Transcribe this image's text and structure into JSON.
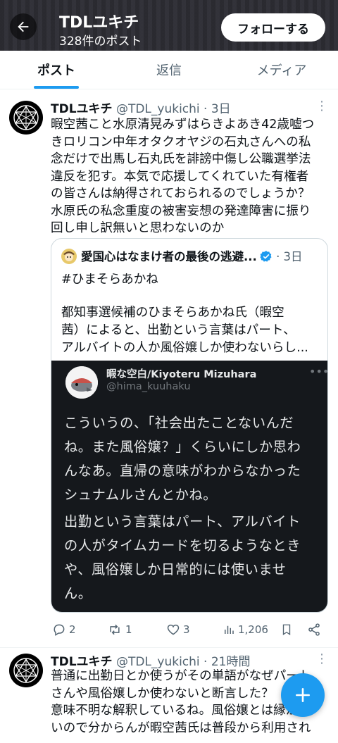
{
  "header": {
    "title": "TDLユキチ",
    "post_count": "328件のポスト",
    "follow_label": "フォローする"
  },
  "tabs": [
    {
      "label": "ポスト",
      "active": true
    },
    {
      "label": "返信",
      "active": false
    },
    {
      "label": "メディア",
      "active": false
    }
  ],
  "tweet1": {
    "name": "TDLユキチ",
    "handle_time": "@TDL_yukichi · 3日",
    "lines": [
      "暇空茜こと水原清晃みずはらきよあき42歳嘘つ",
      "きロリコン中年オタクオヤジの石丸さんへの私",
      "念だけで出馬し石丸氏を誹謗中傷し公職選挙法",
      "違反を犯す。本気で応援してくれていた有権者",
      "の皆さんは納得されておられるのでしょうか？",
      "水原氏の私念重度の被害妄想の発達障害に振り",
      "回し申し訳無いと思わないのか"
    ],
    "quote": {
      "name": "愛国心はなまけ者の最後の逃避...",
      "time": "· 3日",
      "hashtag": "#ひまそらあかね",
      "lines": [
        "都知事選候補のひまそらあかね氏（暇空",
        "茜）によると、出勤という言葉はパート、",
        "アルバイトの人か風俗嬢しか使わないらし..."
      ],
      "embedded": {
        "name": "暇な空白/Kiyoteru Mizuhara",
        "handle": "@hima_kuuhaku",
        "para1": [
          "こういうの、「社会出たことないんだ",
          "ね。また風俗嬢？」くらいにしか思わ",
          "んなあ。直帰の意味がわからなかった",
          "シュナムルさんとかね。"
        ],
        "para2": [
          "出勤という言葉はパート、アルバイト",
          "の人がタイムカードを切るようなとき",
          "や、風俗嬢しか日常的には使いませ",
          "ん。"
        ]
      }
    },
    "stats": {
      "replies": "2",
      "reposts": "1",
      "likes": "3",
      "views": "1,206"
    }
  },
  "tweet2": {
    "name": "TDLユキチ",
    "handle_time": "@TDL_yukichi · 21時間",
    "lines": [
      "普通に出勤日とか使うがその単語がなぜパート",
      "さんや風俗嬢しか使わないと断言した？",
      "意味不明な解釈しているね。風俗嬢とは縁がな",
      "いので分からんが暇空茜氏は普段から利用され"
    ]
  },
  "colors": {
    "accent": "#1d9bf0",
    "text": "#0f1419",
    "muted": "#536471",
    "dark_card": "#15181c"
  }
}
